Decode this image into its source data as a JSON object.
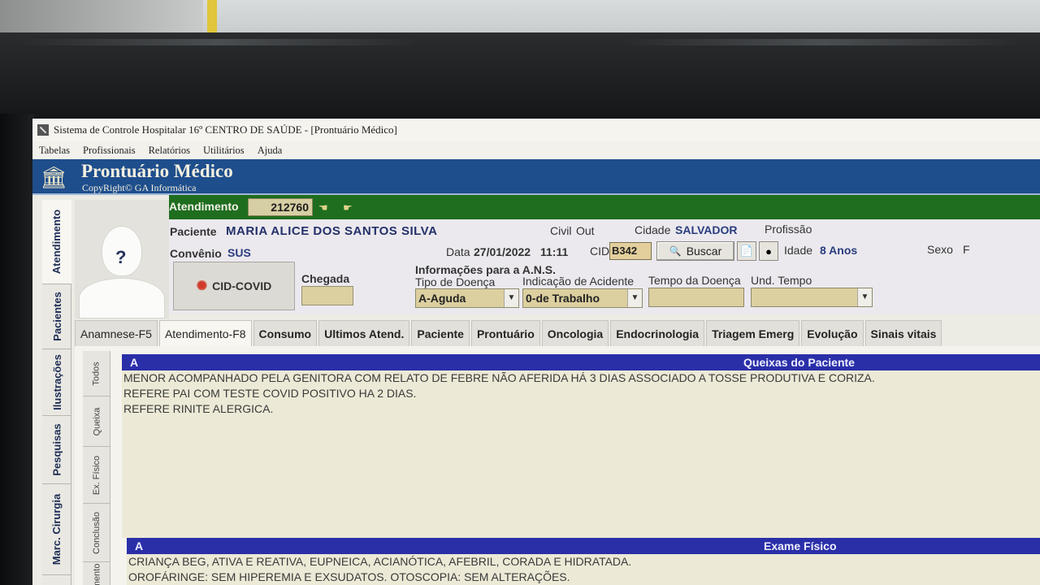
{
  "window": {
    "title": "Sistema de Controle Hospitalar 16º CENTRO DE SAÚDE - [Prontuário Médico]",
    "menu": [
      "Tabelas",
      "Profissionais",
      "Relatórios",
      "Utilitários",
      "Ajuda"
    ]
  },
  "banner": {
    "title": "Prontuário Médico",
    "copyright": "CopyRight© GA Informática"
  },
  "side_tabs": [
    "Atendimento",
    "Pacientes",
    "Ilustrações",
    "Pesquisas",
    "Marc. Cirurgia"
  ],
  "atendimento": {
    "label": "Atendimento",
    "number": "212760"
  },
  "patient": {
    "paciente_label": "Paciente",
    "name": "MARIA ALICE DOS SANTOS SILVA",
    "civil_label": "Civil",
    "civil_value": "Out",
    "cidade_label": "Cidade",
    "cidade_value": "SALVADOR",
    "profissao_label": "Profissão",
    "convenio_label": "Convênio",
    "convenio_value": "SUS",
    "data_label": "Data",
    "data_value": "27/01/2022",
    "hora_value": "11:11",
    "cid_label": "CID",
    "cid_value": "B342",
    "buscar_label": "Buscar",
    "idade_label": "Idade",
    "idade_value": "8 Anos",
    "sexo_label": "Sexo",
    "sexo_value": "F"
  },
  "covid_button": "CID-COVID",
  "chegada_label": "Chegada",
  "ans": {
    "title": "Informações para a A.N.S.",
    "tipo_label": "Tipo de Doença",
    "tipo_value": "A-Aguda",
    "indicacao_label": "Indicação de Acidente",
    "indicacao_value": "0-de Trabalho",
    "tempo_label": "Tempo da Doença",
    "und_label": "Und. Tempo"
  },
  "tabs": [
    "Anamnese-F5",
    "Atendimento-F8",
    "Consumo",
    "Ultimos Atend.",
    "Paciente",
    "Prontuário",
    "Oncologia",
    "Endocrinologia",
    "Triagem Emerg",
    "Evolução",
    "Sinais vitais"
  ],
  "sub_tabs": [
    "Todos",
    "Queixa",
    "Ex. Físico",
    "Conclusão",
    "amento"
  ],
  "queixas": {
    "marker": "A",
    "title": "Queixas do Paciente",
    "lines": [
      "MENOR ACOMPANHADO PELA GENITORA COM RELATO DE FEBRE NÃO AFERIDA HÁ 3 DIAS ASSOCIADO A TOSSE PRODUTIVA E CORIZA.",
      "REFERE PAI COM TESTE COVID POSITIVO HA 2 DIAS.",
      "REFERE RINITE ALERGICA."
    ]
  },
  "exame": {
    "marker": "A",
    "title": "Exame Físico",
    "lines": [
      "CRIANÇA BEG, ATIVA E REATIVA, EUPNEICA, ACIANÓTICA, AFEBRIL, CORADA E HIDRATADA.",
      "OROFÁRINGE: SEM HIPEREMIA E EXSUDATOS. OTOSCOPIA: SEM ALTERAÇÕES."
    ]
  },
  "colors": {
    "banner": "#1e4e8c",
    "atendimento_bar": "#1f6d1f",
    "section_bar": "#2a2fa8",
    "field_bg": "#dccfa0"
  }
}
